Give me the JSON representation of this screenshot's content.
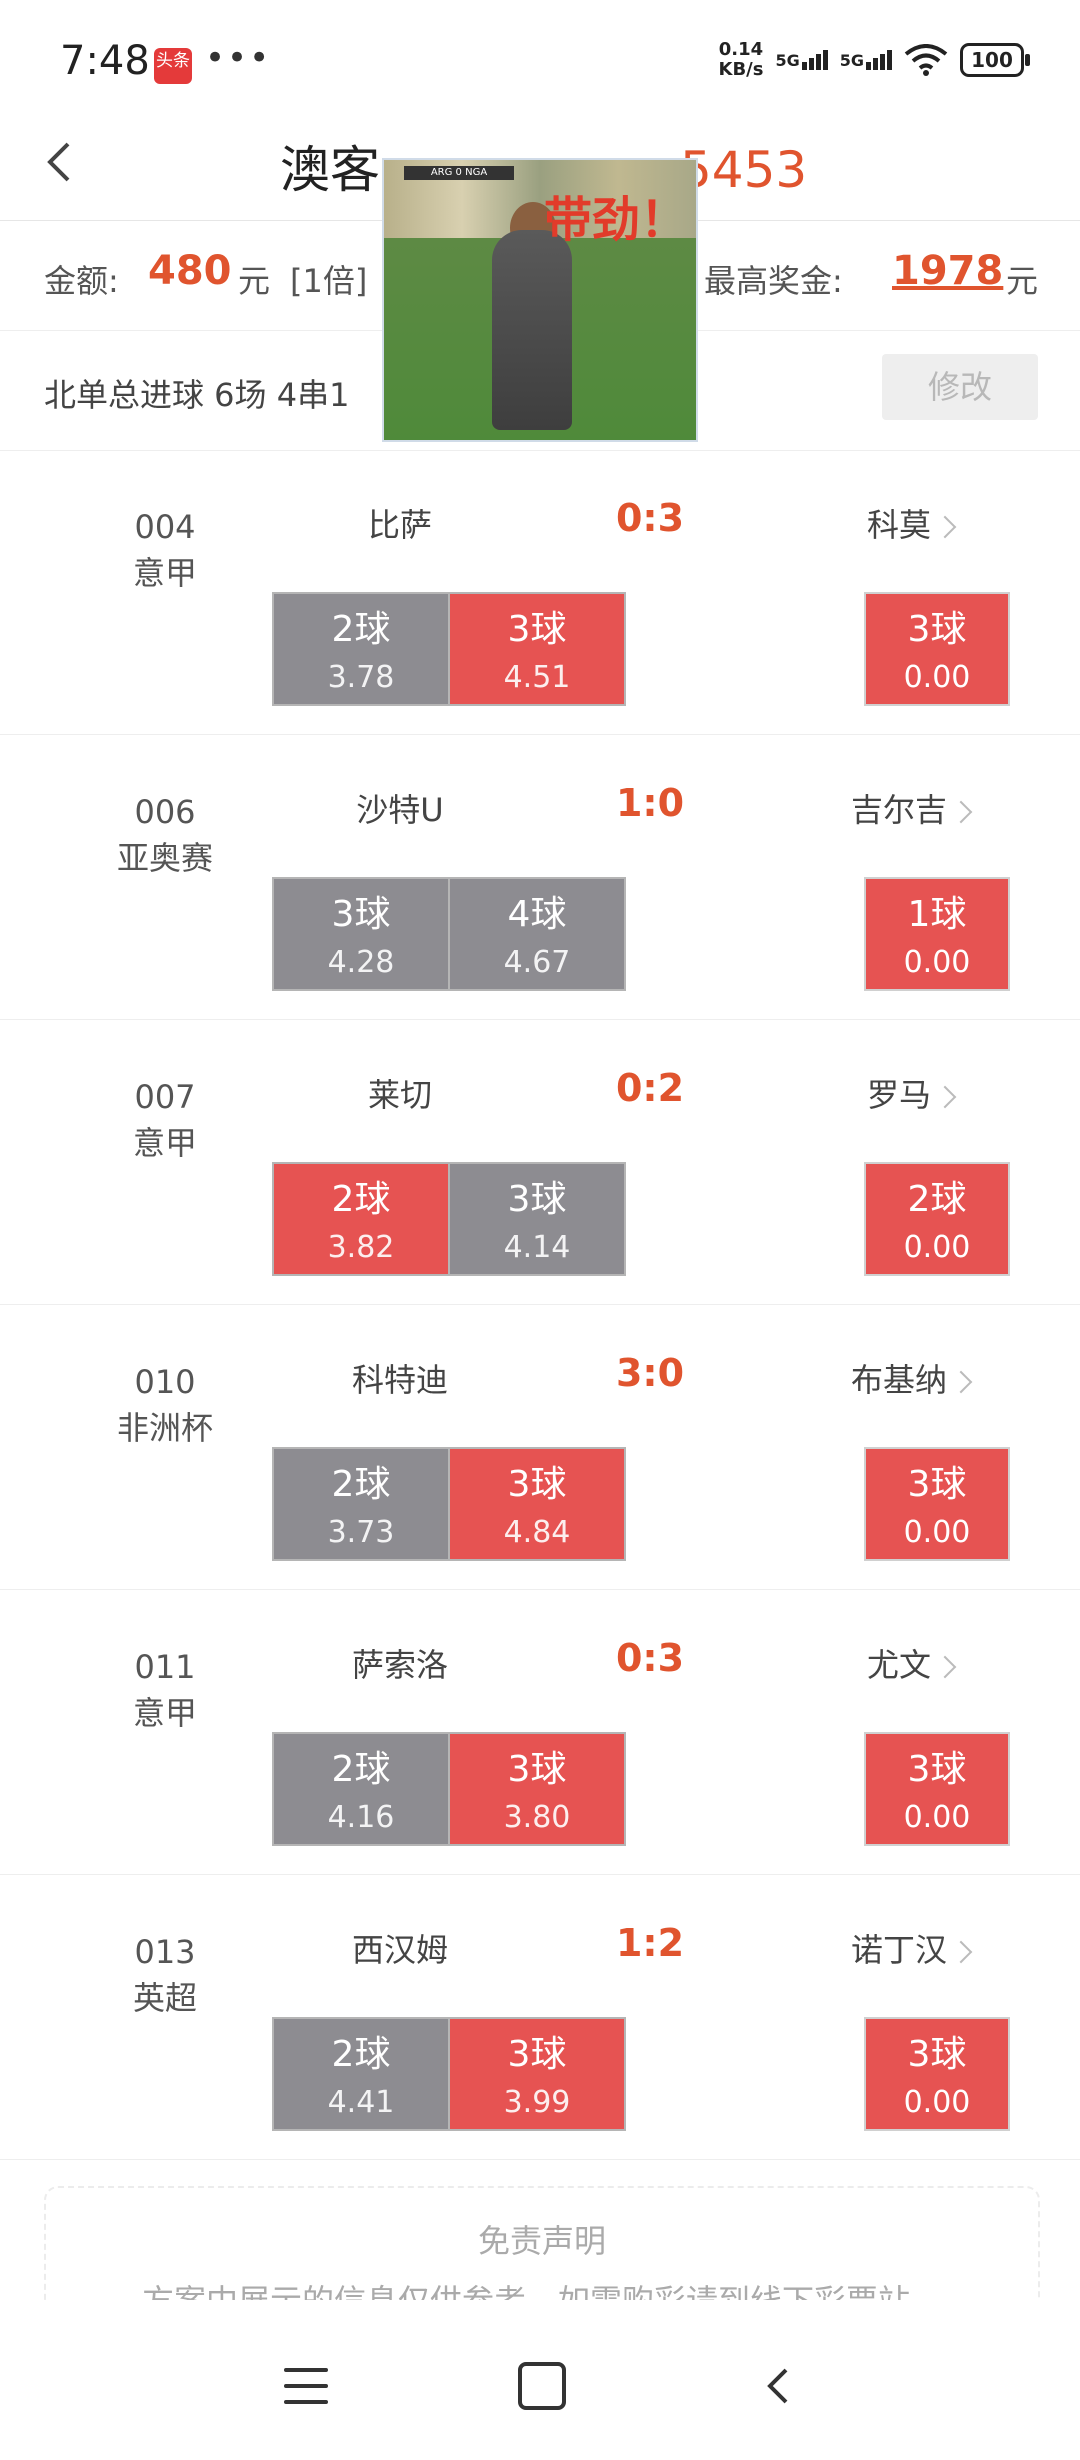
{
  "status_bar": {
    "time": "7:48",
    "app_badge": "头条",
    "more": "•••",
    "net_speed_value": "0.14",
    "net_speed_unit": "KB/s",
    "sim1": "5G",
    "sim2": "5G",
    "battery": "100"
  },
  "header": {
    "title": "澳客",
    "title_number": "5453",
    "back_icon": "chevron-left-icon",
    "video_caption": "带劲！",
    "video_scoreboard": "ARG 0 NGA"
  },
  "summary": {
    "amount_label": "金额:",
    "amount_value": "480",
    "amount_unit": "元",
    "multiplier": "[1倍]",
    "prize_label": "最高奖金:",
    "prize_value": "1978",
    "prize_unit": "元"
  },
  "play": {
    "type": "北单总进球 6场 4串1",
    "modify_label": "修改"
  },
  "matches": [
    {
      "no": "004",
      "league": "意甲",
      "home": "比萨",
      "score": "0:3",
      "away": "科莫",
      "opt1": {
        "goals": "2球",
        "odds": "3.78"
      },
      "opt2": {
        "goals": "3球",
        "odds": "4.51"
      },
      "result": {
        "goals": "3球",
        "odds": "0.00"
      }
    },
    {
      "no": "006",
      "league": "亚奥赛",
      "home": "沙特U",
      "score": "1:0",
      "away": "吉尔吉",
      "opt1": {
        "goals": "3球",
        "odds": "4.28"
      },
      "opt2": {
        "goals": "4球",
        "odds": "4.67"
      },
      "result": {
        "goals": "1球",
        "odds": "0.00"
      }
    },
    {
      "no": "007",
      "league": "意甲",
      "home": "莱切",
      "score": "0:2",
      "away": "罗马",
      "opt1": {
        "goals": "2球",
        "odds": "3.82"
      },
      "opt2": {
        "goals": "3球",
        "odds": "4.14"
      },
      "result": {
        "goals": "2球",
        "odds": "0.00"
      }
    },
    {
      "no": "010",
      "league": "非洲杯",
      "home": "科特迪",
      "score": "3:0",
      "away": "布基纳",
      "opt1": {
        "goals": "2球",
        "odds": "3.73"
      },
      "opt2": {
        "goals": "3球",
        "odds": "4.84"
      },
      "result": {
        "goals": "3球",
        "odds": "0.00"
      }
    },
    {
      "no": "011",
      "league": "意甲",
      "home": "萨索洛",
      "score": "0:3",
      "away": "尤文",
      "opt1": {
        "goals": "2球",
        "odds": "4.16"
      },
      "opt2": {
        "goals": "3球",
        "odds": "3.80"
      },
      "result": {
        "goals": "3球",
        "odds": "0.00"
      }
    },
    {
      "no": "013",
      "league": "英超",
      "home": "西汉姆",
      "score": "1:2",
      "away": "诺丁汉",
      "opt1": {
        "goals": "2球",
        "odds": "4.41"
      },
      "opt2": {
        "goals": "3球",
        "odds": "3.99"
      },
      "result": {
        "goals": "3球",
        "odds": "0.00"
      }
    }
  ],
  "disclaimer": {
    "title": "免责声明",
    "text": "方案中展示的信息仅供参考，如需购彩请到线下彩票站。"
  },
  "colors": {
    "accent": "#e0542e",
    "selected_red": "#e65352",
    "unselected_gray": "#8d8c91"
  }
}
